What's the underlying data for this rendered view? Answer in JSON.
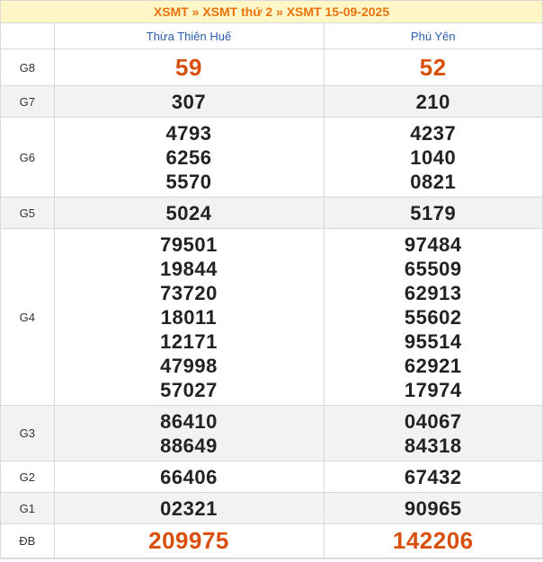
{
  "breadcrumb": {
    "items": [
      "XSMT",
      "XSMT thứ 2",
      "XSMT 15-09-2025"
    ],
    "sep": " » "
  },
  "provinces": [
    "Thừa Thiên Huế",
    "Phú Yên"
  ],
  "prizes": [
    {
      "label": "G8",
      "cols": [
        [
          "59"
        ],
        [
          "52"
        ]
      ]
    },
    {
      "label": "G7",
      "cols": [
        [
          "307"
        ],
        [
          "210"
        ]
      ]
    },
    {
      "label": "G6",
      "cols": [
        [
          "4793",
          "6256",
          "5570"
        ],
        [
          "4237",
          "1040",
          "0821"
        ]
      ]
    },
    {
      "label": "G5",
      "cols": [
        [
          "5024"
        ],
        [
          "5179"
        ]
      ]
    },
    {
      "label": "G4",
      "cols": [
        [
          "79501",
          "19844",
          "73720",
          "18011",
          "12171",
          "47998",
          "57027"
        ],
        [
          "97484",
          "65509",
          "62913",
          "55602",
          "95514",
          "62921",
          "17974"
        ]
      ]
    },
    {
      "label": "G3",
      "cols": [
        [
          "86410",
          "88649"
        ],
        [
          "04067",
          "84318"
        ]
      ]
    },
    {
      "label": "G2",
      "cols": [
        [
          "66406"
        ],
        [
          "67432"
        ]
      ]
    },
    {
      "label": "G1",
      "cols": [
        [
          "02321"
        ],
        [
          "90965"
        ]
      ]
    },
    {
      "label": "ĐB",
      "cols": [
        [
          "209975"
        ],
        [
          "142206"
        ]
      ]
    }
  ],
  "colors": {
    "accent": "#e8730c",
    "special": "#d9500e",
    "header_text": "#2a5ea8",
    "title_bg": "#fff6c8"
  }
}
